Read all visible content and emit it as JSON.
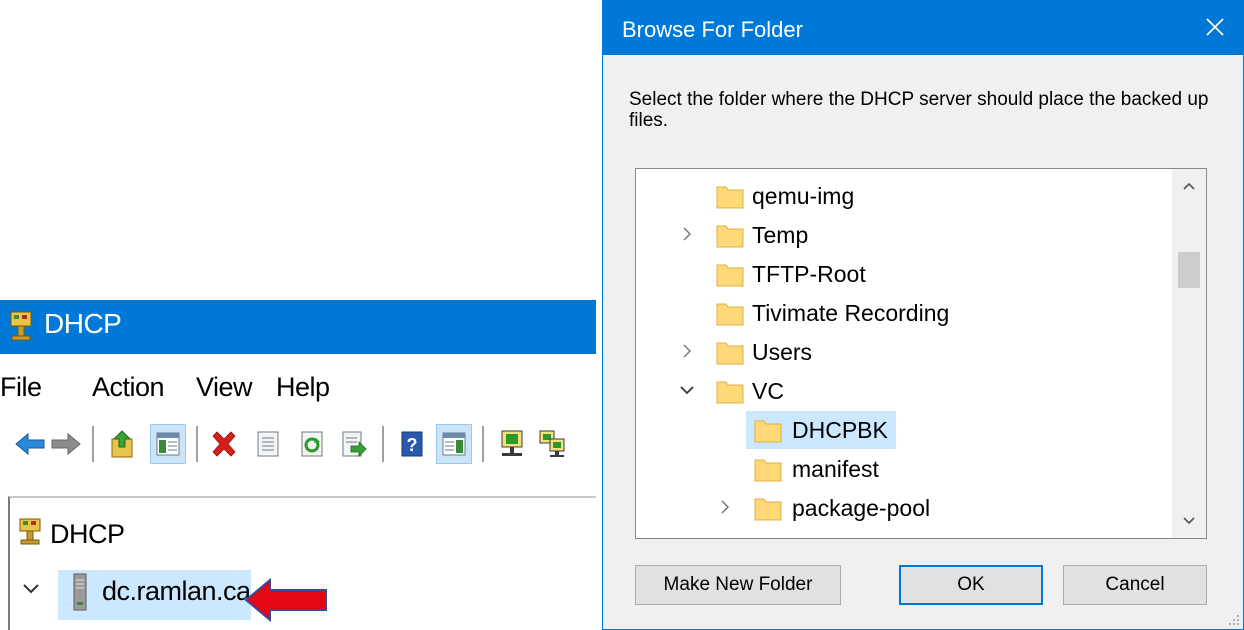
{
  "dhcp_window": {
    "title": "DHCP",
    "menu": [
      "File",
      "Action",
      "View",
      "Help"
    ],
    "toolbar_icons": [
      "back-arrow-icon",
      "forward-arrow-icon",
      "up-one-level-icon",
      "show-hide-console-tree-icon",
      "delete-icon",
      "properties-icon",
      "refresh-icon",
      "export-list-icon",
      "help-icon",
      "show-hide-action-pane-icon",
      "authorize-server-icon",
      "manage-authorized-servers-icon"
    ],
    "tree": {
      "root_label": "DHCP",
      "server_label": "dc.ramlan.ca"
    },
    "accent_color": "#0078d7",
    "arrow_color": "#e30613"
  },
  "browse_dialog": {
    "title": "Browse For Folder",
    "instruction": "Select the folder where the DHCP server should place the backed up files.",
    "folders": [
      {
        "name": "qemu-img",
        "depth": 0,
        "expander": "none",
        "selected": false
      },
      {
        "name": "Temp",
        "depth": 0,
        "expander": "collapsed",
        "selected": false
      },
      {
        "name": "TFTP-Root",
        "depth": 0,
        "expander": "none",
        "selected": false
      },
      {
        "name": "Tivimate Recording",
        "depth": 0,
        "expander": "none",
        "selected": false
      },
      {
        "name": "Users",
        "depth": 0,
        "expander": "collapsed",
        "selected": false
      },
      {
        "name": "VC",
        "depth": 0,
        "expander": "expanded",
        "selected": false
      },
      {
        "name": "DHCPBK",
        "depth": 1,
        "expander": "none",
        "selected": true
      },
      {
        "name": "manifest",
        "depth": 1,
        "expander": "none",
        "selected": false
      },
      {
        "name": "package-pool",
        "depth": 1,
        "expander": "collapsed",
        "selected": false
      }
    ],
    "buttons": {
      "make_new_folder": "Make New Folder",
      "ok": "OK",
      "cancel": "Cancel"
    },
    "selection_color": "#cce8ff"
  }
}
